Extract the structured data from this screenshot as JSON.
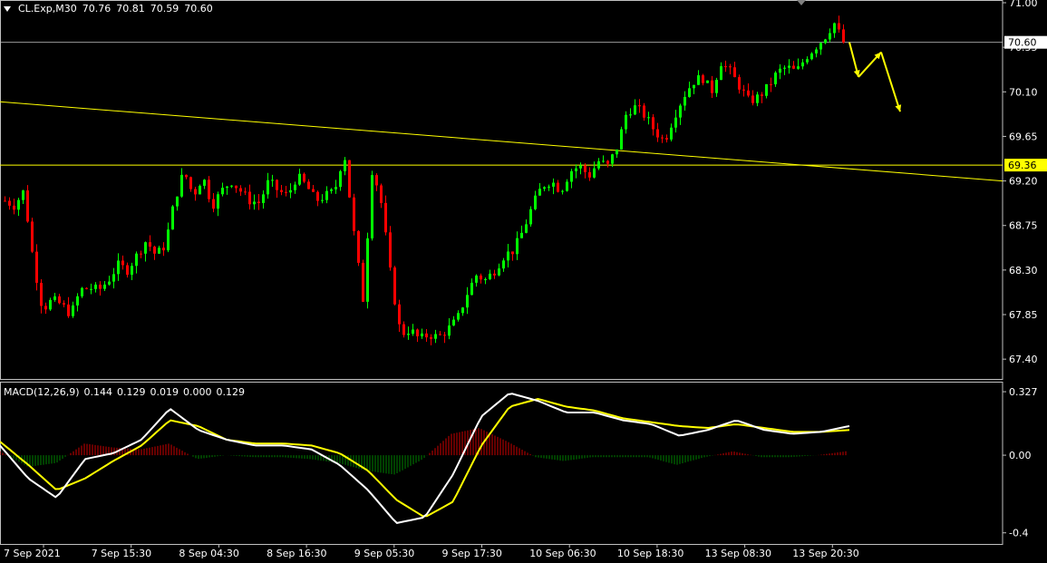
{
  "header": {
    "symbol": "CL.Exp,M30",
    "open": "70.76",
    "high": "70.81",
    "low": "70.59",
    "close": "70.60"
  },
  "macd_header": {
    "name": "MACD(12,26,9)",
    "values": [
      "0.144",
      "0.129",
      "0.019",
      "0.000",
      "0.129"
    ]
  },
  "colors": {
    "background": "#000000",
    "bull_candle": "#00ff00",
    "bear_candle": "#ff0000",
    "trendline": "#ffff00",
    "price_line": "#c0c0c0",
    "macd_line": "#ffffff",
    "signal_line": "#ffff00",
    "histogram_positive": "#cc0000",
    "histogram_negative": "#008000",
    "arrow": "#ffff00"
  },
  "chart_data": {
    "type": "candlestick",
    "symbol": "CL.Exp",
    "timeframe": "M30",
    "price_axis": {
      "range": [
        67.2,
        71.0
      ],
      "ticks": [
        "71.00",
        "70.55",
        "70.10",
        "69.65",
        "69.20",
        "68.75",
        "68.30",
        "67.85",
        "67.40"
      ]
    },
    "current_price_label": "70.60",
    "horizontal_level_label": "69.36",
    "horizontal_level": 69.36,
    "current_price": 70.6,
    "x_axis_labels": [
      "7 Sep 2021",
      "7 Sep 15:30",
      "8 Sep 04:30",
      "8 Sep 16:30",
      "9 Sep 05:30",
      "9 Sep 17:30",
      "10 Sep 06:30",
      "10 Sep 18:30",
      "13 Sep 08:30",
      "13 Sep 20:30"
    ],
    "descending_trendline": {
      "start_price": 70.0,
      "end_price": 69.2
    },
    "price_path": [
      69.0,
      68.95,
      69.1,
      68.4,
      67.9,
      68.0,
      67.95,
      67.85,
      68.1,
      68.12,
      68.1,
      68.2,
      68.35,
      68.3,
      68.45,
      68.6,
      68.45,
      68.55,
      69.0,
      69.3,
      69.05,
      69.25,
      68.95,
      69.1,
      69.2,
      69.1,
      69.0,
      68.98,
      69.2,
      69.1,
      69.05,
      69.25,
      69.15,
      69.0,
      69.05,
      69.1,
      69.5,
      68.7,
      68.0,
      69.35,
      68.95,
      68.2,
      67.65,
      67.7,
      67.6,
      67.65,
      67.62,
      67.7,
      67.8,
      68.05,
      68.25,
      68.2,
      68.3,
      68.45,
      68.5,
      68.7,
      68.95,
      69.15,
      69.2,
      69.1,
      69.3,
      69.35,
      69.25,
      69.4,
      69.35,
      69.55,
      69.9,
      69.95,
      69.85,
      69.7,
      69.6,
      69.85,
      70.05,
      70.2,
      70.25,
      70.1,
      70.4,
      70.3,
      70.15,
      70.0,
      70.05,
      70.15,
      70.3,
      70.35,
      70.3,
      70.45,
      70.55,
      70.65,
      70.8,
      70.6
    ],
    "macd": {
      "axis_ticks": [
        "0.327",
        "0.00",
        "-0.4"
      ],
      "range": [
        -0.42,
        0.36
      ],
      "macd_path": [
        0.05,
        -0.12,
        -0.22,
        -0.02,
        0.01,
        0.08,
        0.24,
        0.13,
        0.08,
        0.05,
        0.05,
        0.03,
        -0.05,
        -0.18,
        -0.35,
        -0.32,
        -0.1,
        0.2,
        0.32,
        0.28,
        0.22,
        0.22,
        0.18,
        0.16,
        0.1,
        0.13,
        0.18,
        0.13,
        0.11,
        0.12,
        0.15
      ],
      "signal_path": [
        0.07,
        -0.05,
        -0.18,
        -0.12,
        -0.03,
        0.05,
        0.18,
        0.15,
        0.08,
        0.06,
        0.06,
        0.05,
        0.01,
        -0.08,
        -0.23,
        -0.32,
        -0.24,
        0.05,
        0.25,
        0.29,
        0.25,
        0.23,
        0.19,
        0.17,
        0.15,
        0.14,
        0.16,
        0.14,
        0.12,
        0.12,
        0.13
      ],
      "histogram": [
        0.02,
        -0.06,
        -0.04,
        0.06,
        0.04,
        0.03,
        0.06,
        -0.02,
        0.0,
        -0.01,
        -0.01,
        -0.02,
        -0.04,
        -0.08,
        -0.1,
        -0.02,
        0.11,
        0.14,
        0.07,
        -0.01,
        -0.03,
        -0.01,
        -0.01,
        -0.01,
        -0.05,
        -0.01,
        0.02,
        -0.01,
        -0.01,
        0.0,
        0.02
      ]
    },
    "projection_arrows": [
      {
        "from": 70.6,
        "to": 70.25
      },
      {
        "from": 70.25,
        "to": 70.5
      },
      {
        "from": 70.5,
        "to": 69.9
      }
    ]
  }
}
